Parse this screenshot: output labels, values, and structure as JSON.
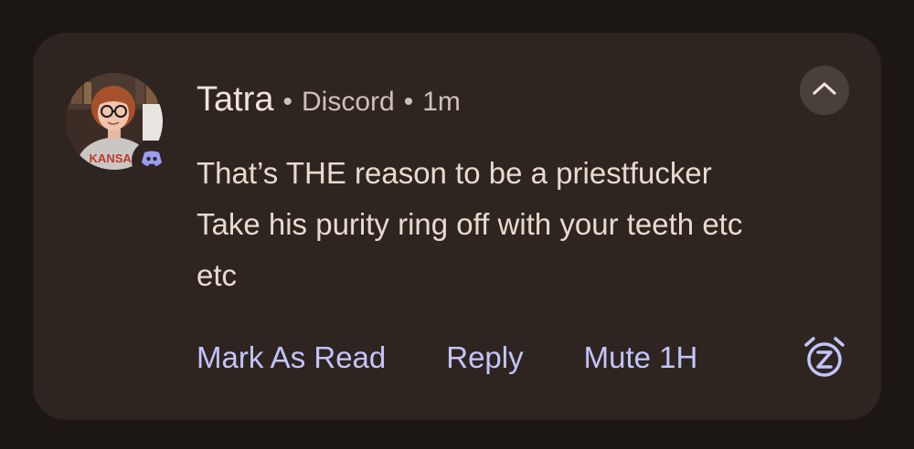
{
  "notification": {
    "sender": "Tatra",
    "app_name": "Discord",
    "time_ago": "1m",
    "separator": "•",
    "message_lines": [
      "That’s THE reason to be a priestfucker",
      "Take his purity ring off with your teeth etc",
      "etc"
    ],
    "avatar_shirt_text": "KANSAS",
    "app_icon": "discord-icon",
    "expand_icon": "chevron-up-icon",
    "accent_color": "#c4c4ff"
  },
  "actions": {
    "mark_as_read": "Mark As Read",
    "reply": "Reply",
    "mute": "Mute 1H",
    "snooze_icon": "snooze-alarm-icon"
  }
}
